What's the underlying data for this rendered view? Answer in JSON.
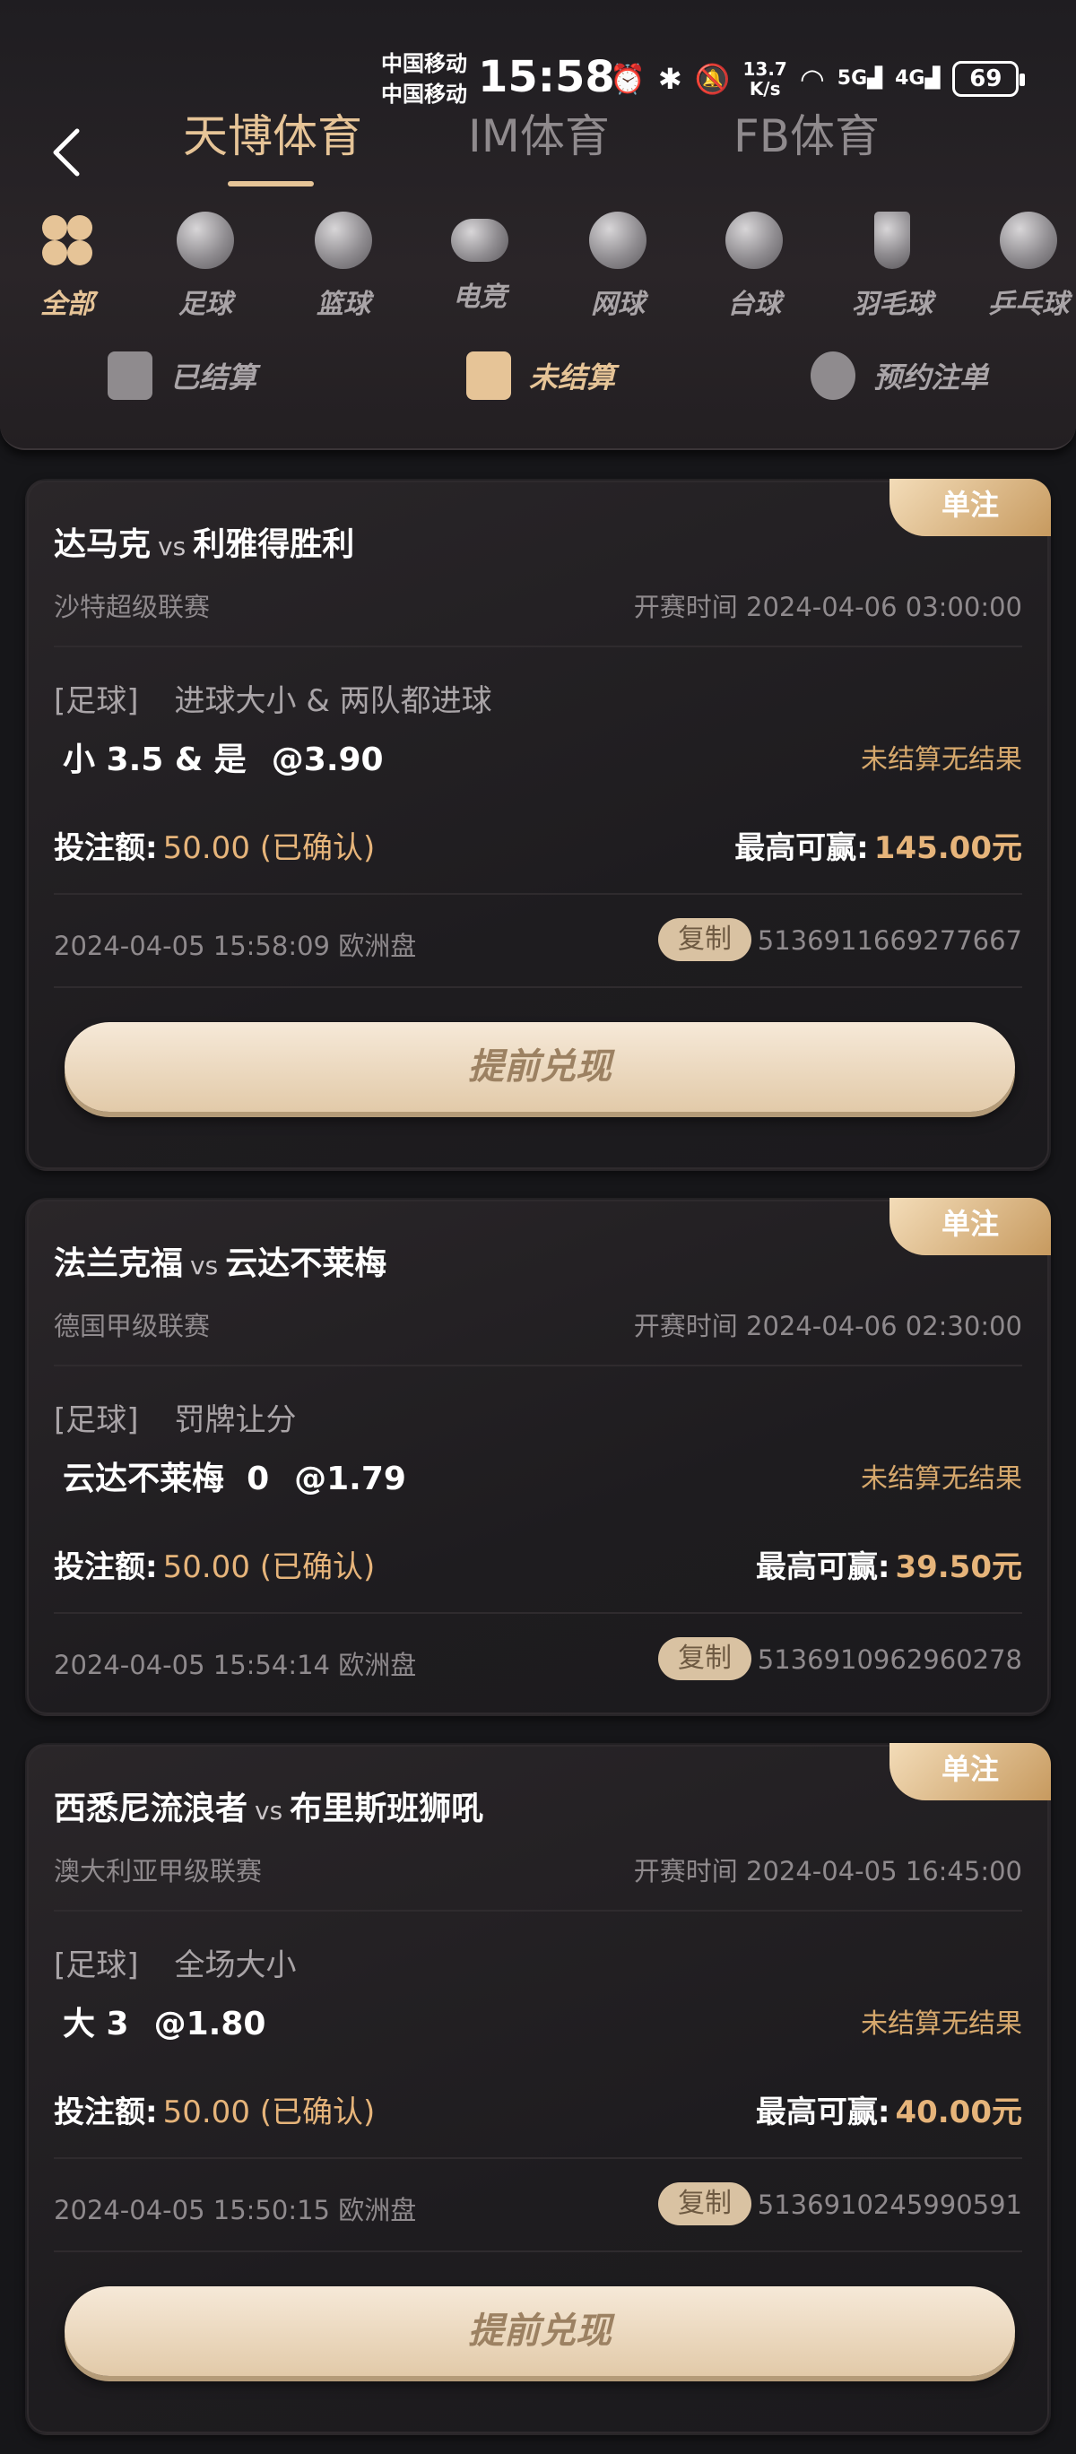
{
  "status": {
    "carrier1": "中国移动",
    "carrier2": "中国移动",
    "time": "15:58",
    "net_speed_value": "13.7",
    "net_speed_unit": "K/s",
    "signal1": "5G",
    "signal2": "4G",
    "battery": "69"
  },
  "tabs": [
    {
      "label": "天博体育",
      "active": true
    },
    {
      "label": "IM体育",
      "active": false
    },
    {
      "label": "FB体育",
      "active": false
    }
  ],
  "sports": [
    {
      "label": "全部",
      "icon": "all-icon",
      "active": true
    },
    {
      "label": "足球",
      "icon": "football-icon"
    },
    {
      "label": "篮球",
      "icon": "basketball-icon"
    },
    {
      "label": "电竞",
      "icon": "gamepad-icon"
    },
    {
      "label": "网球",
      "icon": "tennis-icon"
    },
    {
      "label": "台球",
      "icon": "billiards-icon"
    },
    {
      "label": "羽毛球",
      "icon": "badminton-icon"
    },
    {
      "label": "乒乓球",
      "icon": "pingpong-icon"
    }
  ],
  "filters": [
    {
      "label": "已结算",
      "icon": "settled-icon"
    },
    {
      "label": "未结算",
      "icon": "unsettled-icon",
      "active": true
    },
    {
      "label": "预约注单",
      "icon": "alarm-clock-icon"
    }
  ],
  "colors": {
    "accent": "#e6c497",
    "background": "#161619"
  },
  "bets": [
    {
      "badge": "单注",
      "home": "达马克",
      "vs": "vs",
      "away": "利雅得胜利",
      "league": "沙特超级联赛",
      "start_time": "开赛时间 2024-04-06 03:00:00",
      "sport": "[足球]",
      "market": "进球大小 & 两队都进球",
      "selection": "小 3.5 & 是",
      "odds": "@3.90",
      "result": "未结算无结果",
      "stake_label": "投注额:",
      "stake": "50.00 (已确认)",
      "win_label": "最高可赢:",
      "win": "145.00元",
      "placed": "2024-04-05 15:58:09 欧洲盘",
      "copy": "复制",
      "order": "5136911669277667",
      "cashout": "提前兑现"
    },
    {
      "badge": "单注",
      "home": "法兰克福",
      "vs": "vs",
      "away": "云达不莱梅",
      "league": "德国甲级联赛",
      "start_time": "开赛时间 2024-04-06 02:30:00",
      "sport": "[足球]",
      "market": "罚牌让分",
      "selection": "云达不莱梅  0",
      "odds": "@1.79",
      "result": "未结算无结果",
      "stake_label": "投注额:",
      "stake": "50.00 (已确认)",
      "win_label": "最高可赢:",
      "win": "39.50元",
      "placed": "2024-04-05 15:54:14 欧洲盘",
      "copy": "复制",
      "order": "5136910962960278"
    },
    {
      "badge": "单注",
      "home": "西悉尼流浪者",
      "vs": "vs",
      "away": "布里斯班狮吼",
      "league": "澳大利亚甲级联赛",
      "start_time": "开赛时间 2024-04-05 16:45:00",
      "sport": "[足球]",
      "market": "全场大小",
      "selection": "大 3",
      "odds": "@1.80",
      "result": "未结算无结果",
      "stake_label": "投注额:",
      "stake": "50.00 (已确认)",
      "win_label": "最高可赢:",
      "win": "40.00元",
      "placed": "2024-04-05 15:50:15 欧洲盘",
      "copy": "复制",
      "order": "5136910245990591",
      "cashout": "提前兑现"
    }
  ]
}
